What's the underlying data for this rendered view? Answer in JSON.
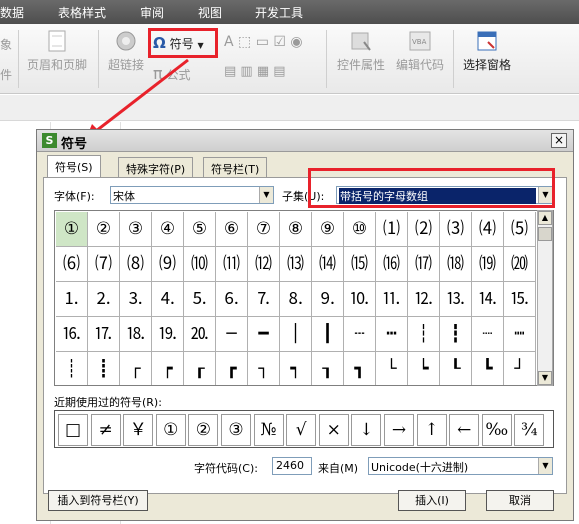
{
  "ribbon": {
    "menus": [
      "数据",
      "表格样式",
      "审阅",
      "视图",
      "开发工具"
    ],
    "left_cut": [
      "象",
      "件"
    ],
    "header_footer": "页眉和页脚",
    "hyperlink": "超链接",
    "symbol": "符号",
    "formula": "公式",
    "control_props": "控件属性",
    "edit_code": "编辑代码",
    "select_pane": "选择窗格"
  },
  "dialog": {
    "title": "符号",
    "close": "×",
    "tabs": [
      "符号(S)",
      "特殊字符(P)",
      "符号栏(T)"
    ],
    "font_label": "字体(F):",
    "font_value": "宋体",
    "subset_label": "子集(U):",
    "subset_value": "带括号的字母数组",
    "symbols": [
      [
        "①",
        "②",
        "③",
        "④",
        "⑤",
        "⑥",
        "⑦",
        "⑧",
        "⑨",
        "⑩",
        "⑴",
        "⑵",
        "⑶",
        "⑷",
        "⑸"
      ],
      [
        "⑹",
        "⑺",
        "⑻",
        "⑼",
        "⑽",
        "⑾",
        "⑿",
        "⒀",
        "⒁",
        "⒂",
        "⒃",
        "⒄",
        "⒅",
        "⒆",
        "⒇"
      ],
      [
        "⒈",
        "⒉",
        "⒊",
        "⒋",
        "⒌",
        "⒍",
        "⒎",
        "⒏",
        "⒐",
        "⒑",
        "⒒",
        "⒓",
        "⒔",
        "⒕",
        "⒖"
      ],
      [
        "⒗",
        "⒘",
        "⒙",
        "⒚",
        "⒛",
        "─",
        "━",
        "│",
        "┃",
        "┄",
        "┅",
        "┆",
        "┇",
        "┈",
        "┉"
      ],
      [
        "┊",
        "┋",
        "┌",
        "┍",
        "┎",
        "┏",
        "┐",
        "┑",
        "┒",
        "┓",
        "└",
        "┕",
        "┖",
        "┗",
        "┘"
      ]
    ],
    "recent_label": "近期使用过的符号(R):",
    "recent": [
      "□",
      "≠",
      "￥",
      "①",
      "②",
      "③",
      "№",
      "√",
      "×",
      "↓",
      "→",
      "↑",
      "←",
      "‰",
      "¾"
    ],
    "charcode_label": "字符代码(C):",
    "charcode_value": "2460",
    "from_label": "来自(M)",
    "from_value": "Unicode(十六进制)",
    "insert_to_bar": "插入到符号栏(Y)",
    "insert": "插入(I)",
    "cancel": "取消"
  },
  "colors": {
    "highlight": "#e8222b",
    "selected_cell": "#cfe6c6",
    "selection_blue": "#0a246a"
  }
}
